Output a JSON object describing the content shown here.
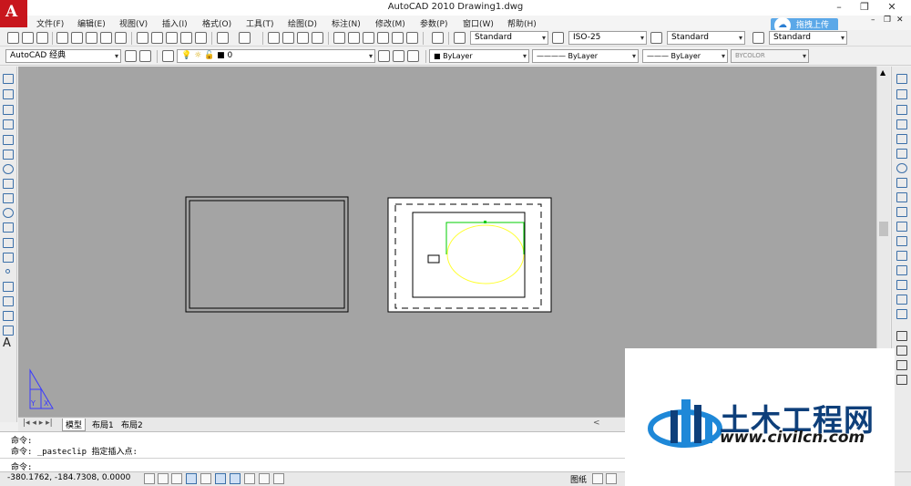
{
  "window": {
    "title": "AutoCAD 2010        Drawing1.dwg",
    "app_logo_letter": "A",
    "minimize": "–",
    "restore": "❐",
    "close": "✕"
  },
  "menubar": {
    "items": [
      "文件(F)",
      "编辑(E)",
      "视图(V)",
      "插入(I)",
      "格式(O)",
      "工具(T)",
      "绘图(D)",
      "标注(N)",
      "修改(M)",
      "参数(P)",
      "窗口(W)",
      "帮助(H)"
    ],
    "doc_min": "–",
    "doc_restore": "❐",
    "doc_close": "✕"
  },
  "cloud_upload": {
    "label": "拖拽上传",
    "icon": "cloud-icon"
  },
  "toolbar1": {
    "text_style": "Standard",
    "dim_style": "ISO-25",
    "table_style": "Standard",
    "mleader_style": "Standard"
  },
  "toolbar2": {
    "workspace": "AutoCAD 经典",
    "layer": "0",
    "color": "ByLayer",
    "linetype": "ByLayer",
    "lineweight": "ByLayer",
    "plotstyle": "BYCOLOR"
  },
  "tabs": {
    "model": "模型",
    "layout1": "布局1",
    "layout2": "布局2"
  },
  "command": {
    "line1": "命令:",
    "line2": "命令: _pasteclip 指定插入点:",
    "prompt": "命令:"
  },
  "status": {
    "coords": "-380.1762, -184.7308, 0.0000",
    "paper_label": "图纸"
  },
  "ucs": {
    "x_label": "X",
    "y_label": "Y"
  },
  "watermark": {
    "name": "土木工程网",
    "url": "www.civilcn.com"
  },
  "colors": {
    "canvas": "#a4a4a4",
    "ellipse": "#ffff33",
    "green_line": "#00cc00",
    "ucs": "#3a3aff",
    "logo_red": "#c8161d"
  }
}
